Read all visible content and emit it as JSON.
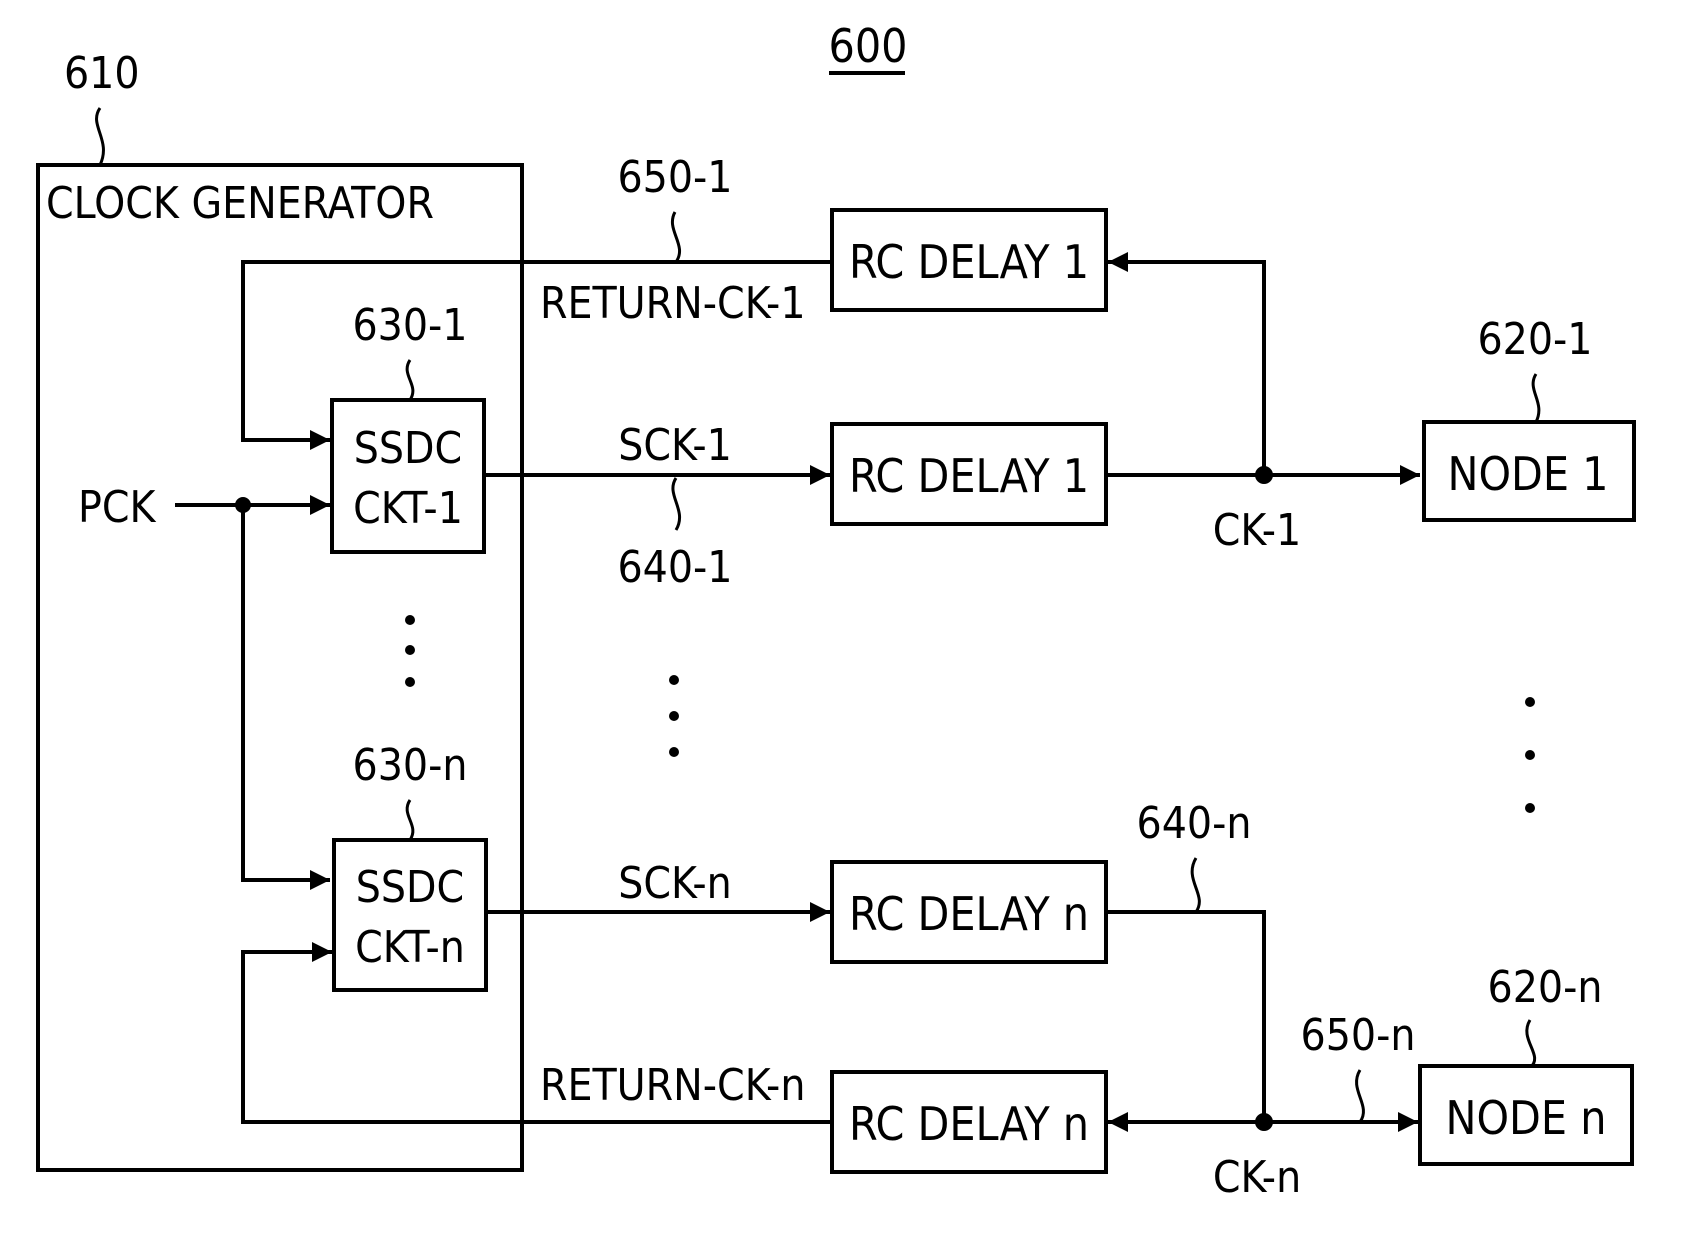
{
  "figure": {
    "number": "600",
    "clock_generator": {
      "ref": "610",
      "label": "CLOCK GENERATOR"
    },
    "input_signal": "PCK",
    "ssdc_circuits": [
      {
        "ref": "630-1",
        "line1": "SSDC",
        "line2": "CKT-1"
      },
      {
        "ref": "630-n",
        "line1": "SSDC",
        "line2": "CKT-n"
      }
    ],
    "rc_delays": [
      {
        "label": "RC DELAY 1",
        "role": "return"
      },
      {
        "label": "RC DELAY 1",
        "role": "forward"
      },
      {
        "label": "RC DELAY n",
        "role": "forward"
      },
      {
        "label": "RC DELAY n",
        "role": "return"
      }
    ],
    "nodes": [
      {
        "ref": "620-1",
        "label": "NODE 1"
      },
      {
        "ref": "620-n",
        "label": "NODE n"
      }
    ],
    "signals": {
      "return_ck_1": "RETURN-CK-1",
      "sck_1": "SCK-1",
      "ck_1": "CK-1",
      "sck_n": "SCK-n",
      "return_ck_n": "RETURN-CK-n",
      "ck_n": "CK-n"
    },
    "refs": {
      "r650_1": "650-1",
      "r640_1": "640-1",
      "r640_n": "640-n",
      "r650_n": "650-n"
    }
  }
}
